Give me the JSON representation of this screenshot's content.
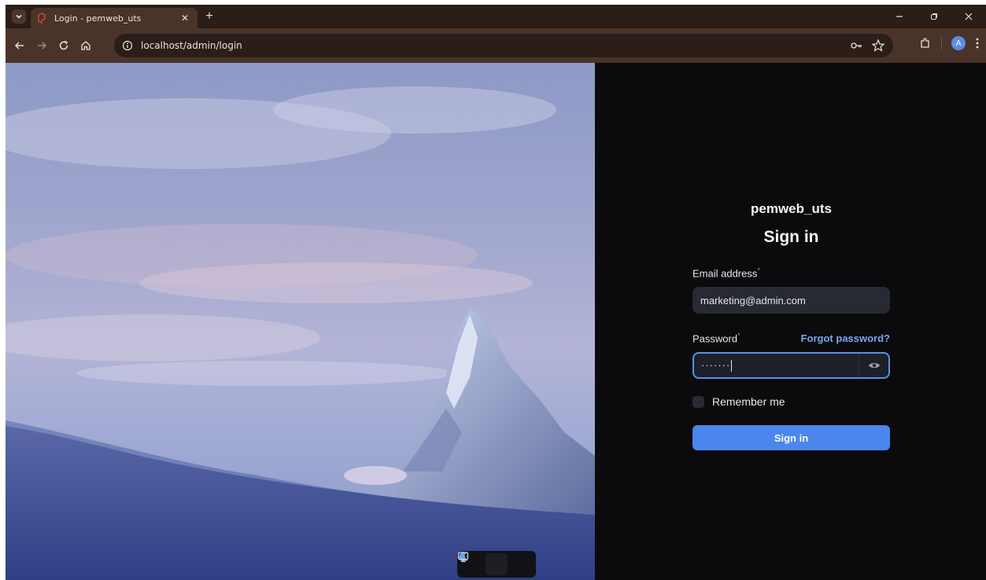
{
  "browser": {
    "tab_title": "Login - pemweb_uts",
    "url": "localhost/admin/login",
    "profile_initial": "A"
  },
  "login": {
    "brand": "pemweb_uts",
    "heading": "Sign in",
    "email_label": "Email address",
    "email_value": "marketing@admin.com",
    "password_label": "Password",
    "password_mask": "·······",
    "required_mark": "*",
    "forgot_link": "Forgot password?",
    "remember_label": "Remember me",
    "remember_checked": false,
    "submit_label": "Sign in"
  },
  "theme_switcher": {
    "options": [
      "light-icon",
      "dark-icon",
      "system-icon"
    ],
    "active": "dark"
  },
  "colors": {
    "accent": "#4a86eb",
    "link": "#79a6f2",
    "panel_bg": "#0b0b0d",
    "chrome_bg": "#4a3328"
  }
}
